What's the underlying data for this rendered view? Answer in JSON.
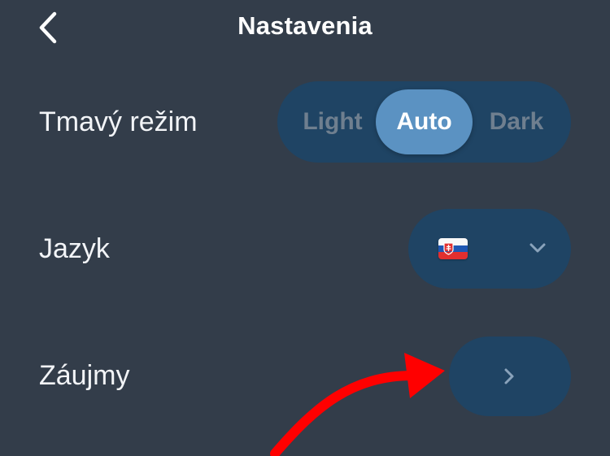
{
  "header": {
    "title": "Nastavenia",
    "back_icon": "chevron-left-icon"
  },
  "dark_mode": {
    "label": "Tmavý režim",
    "options": [
      "Light",
      "Auto",
      "Dark"
    ],
    "selected": "Auto"
  },
  "language": {
    "label": "Jazyk",
    "selected_flag": "slovakia-flag",
    "dropdown_icon": "chevron-down-icon"
  },
  "interests": {
    "label": "Záujmy",
    "open_icon": "chevron-right-icon"
  },
  "colors": {
    "background": "#333d4a",
    "control_bg": "#1f4464",
    "selected_segment": "#5b92c2",
    "annotation_arrow": "#ff0000"
  }
}
